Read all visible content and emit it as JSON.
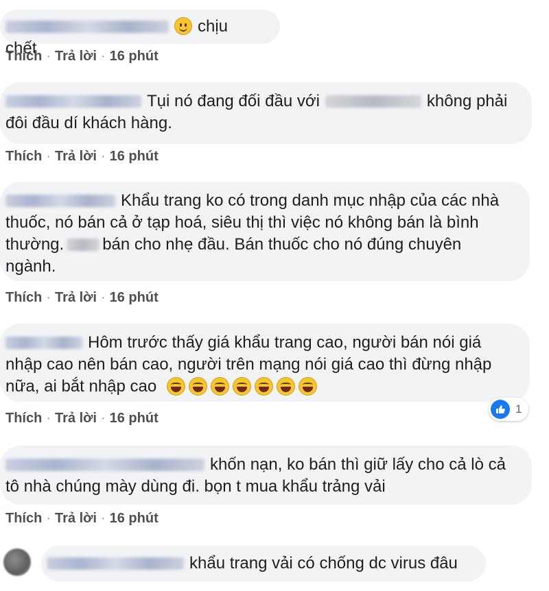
{
  "action_labels": {
    "like": "Thích",
    "reply": "Trả lời",
    "separator": "·"
  },
  "comments": [
    {
      "text": "chịu chết",
      "time": "16 phút"
    },
    {
      "text_a": "Tụi nó đang đối đầu với",
      "text_b": "không phải",
      "text_c": "đôi đầu dí khách hàng.",
      "time": "16 phút"
    },
    {
      "lines": [
        "Khẩu trang ko có trong danh mục nhập của các nhà",
        "thuốc, nó bán cả ở tạp hoá, siêu thị thì việc nó không bán là bình",
        "thường.",
        "bán cho nhẹ đầu. Bán thuốc cho nó đúng chuyên",
        "ngành."
      ],
      "time": "16 phút"
    },
    {
      "lines": [
        "Hôm trước thấy giá khẩu trang cao, người bán nói giá",
        "nhập cao nên bán cao, người trên mạng nói giá cao thì đừng nhập",
        "nữa, ai bắt nhập cao"
      ],
      "time": "16 phút",
      "reaction_count": "1",
      "reaction_icon": "like-icon"
    },
    {
      "lines": [
        "khốn nạn, ko bán thì giữ lấy cho cả lò cả",
        "tô nhà chúng mày dùng đi. bọn t mua khẩu trảng vải"
      ],
      "time": "16 phút"
    },
    {
      "text": "khẩu trang vải có chống dc virus đâu"
    }
  ],
  "colors": {
    "bubble": "#f2f3f5",
    "accent": "#1877f2",
    "text": "#1c1e21",
    "meta": "#606770"
  }
}
